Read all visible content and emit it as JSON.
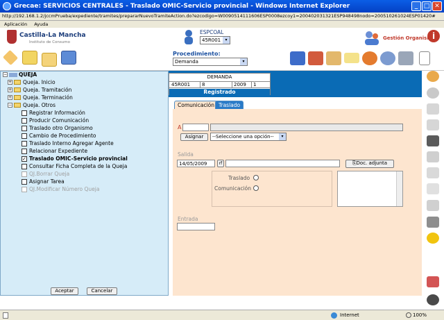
{
  "window": {
    "title": "Grecae: SERVICIOS CENTRALES - Traslado OMIC-Servicio provincial - Windows Internet Explorer",
    "url": "http://192.168.1.2/jccmPrueba/expediente/tramites/prepararNuevoTramiteAction.do?ezcodigo=W0090514111606ESP0008ezcoy1=200402031321ESP948498nodo=200510261024ESP01420#"
  },
  "menu": [
    "Aplicación",
    "Ayuda"
  ],
  "header": {
    "org": "Castilla-La Mancha",
    "org_sub": "Instituto de Consumo",
    "user_code": "ESPCOAL",
    "user_select": "45R001",
    "gestion": "Gestión Organismo",
    "procedimiento_label": "Procedimiento:",
    "procedimiento_value": "Demanda"
  },
  "tree": {
    "root": "QUEJA",
    "folders": [
      "Queja. Inicio",
      "Queja. Tramitación",
      "Queja. Terminación",
      "Queja. Otros"
    ],
    "items": [
      {
        "label": "Registrar Información",
        "checked": false,
        "disabled": false
      },
      {
        "label": "Producir Comunicación",
        "checked": false,
        "disabled": false
      },
      {
        "label": "Traslado otro Organismo",
        "checked": false,
        "disabled": false
      },
      {
        "label": "Cambio de Procedimiento",
        "checked": false,
        "disabled": false
      },
      {
        "label": "Traslado Interno Agregar Agente",
        "checked": false,
        "disabled": false
      },
      {
        "label": "Relacionar Expediente",
        "checked": false,
        "disabled": false
      },
      {
        "label": "Traslado OMIC-Servicio provincial",
        "checked": true,
        "disabled": false
      },
      {
        "label": "Consultar Ficha Completa de la Queja",
        "checked": false,
        "disabled": false
      },
      {
        "label": "QJ.Borrar Queja",
        "checked": false,
        "disabled": true
      },
      {
        "label": "Asignar Tarea",
        "checked": false,
        "disabled": false
      },
      {
        "label": "QJ.Modificar Número Queja",
        "checked": false,
        "disabled": true
      }
    ],
    "accept": "Aceptar",
    "cancel": "Cancelar"
  },
  "demanda": {
    "title": "DEMANDA",
    "c1": "45R001",
    "c2": "8",
    "c3": "2009",
    "c4": "1",
    "status": "Registrado"
  },
  "tabs": [
    "Comunicación",
    "Traslado"
  ],
  "form": {
    "a_label": "A",
    "asignar": "Asignar",
    "select_placeholder": "--Seleccione una opción--",
    "salida_label": "Salida",
    "salida_date": "14/05/2009",
    "rf": "rf",
    "doc_button": "Doc. adjunta",
    "traslado_label": "Traslado",
    "comunicacion_label": "Comunicación",
    "entrada_label": "Entrada"
  },
  "status": {
    "zone": "Internet",
    "zoom": "100%"
  }
}
